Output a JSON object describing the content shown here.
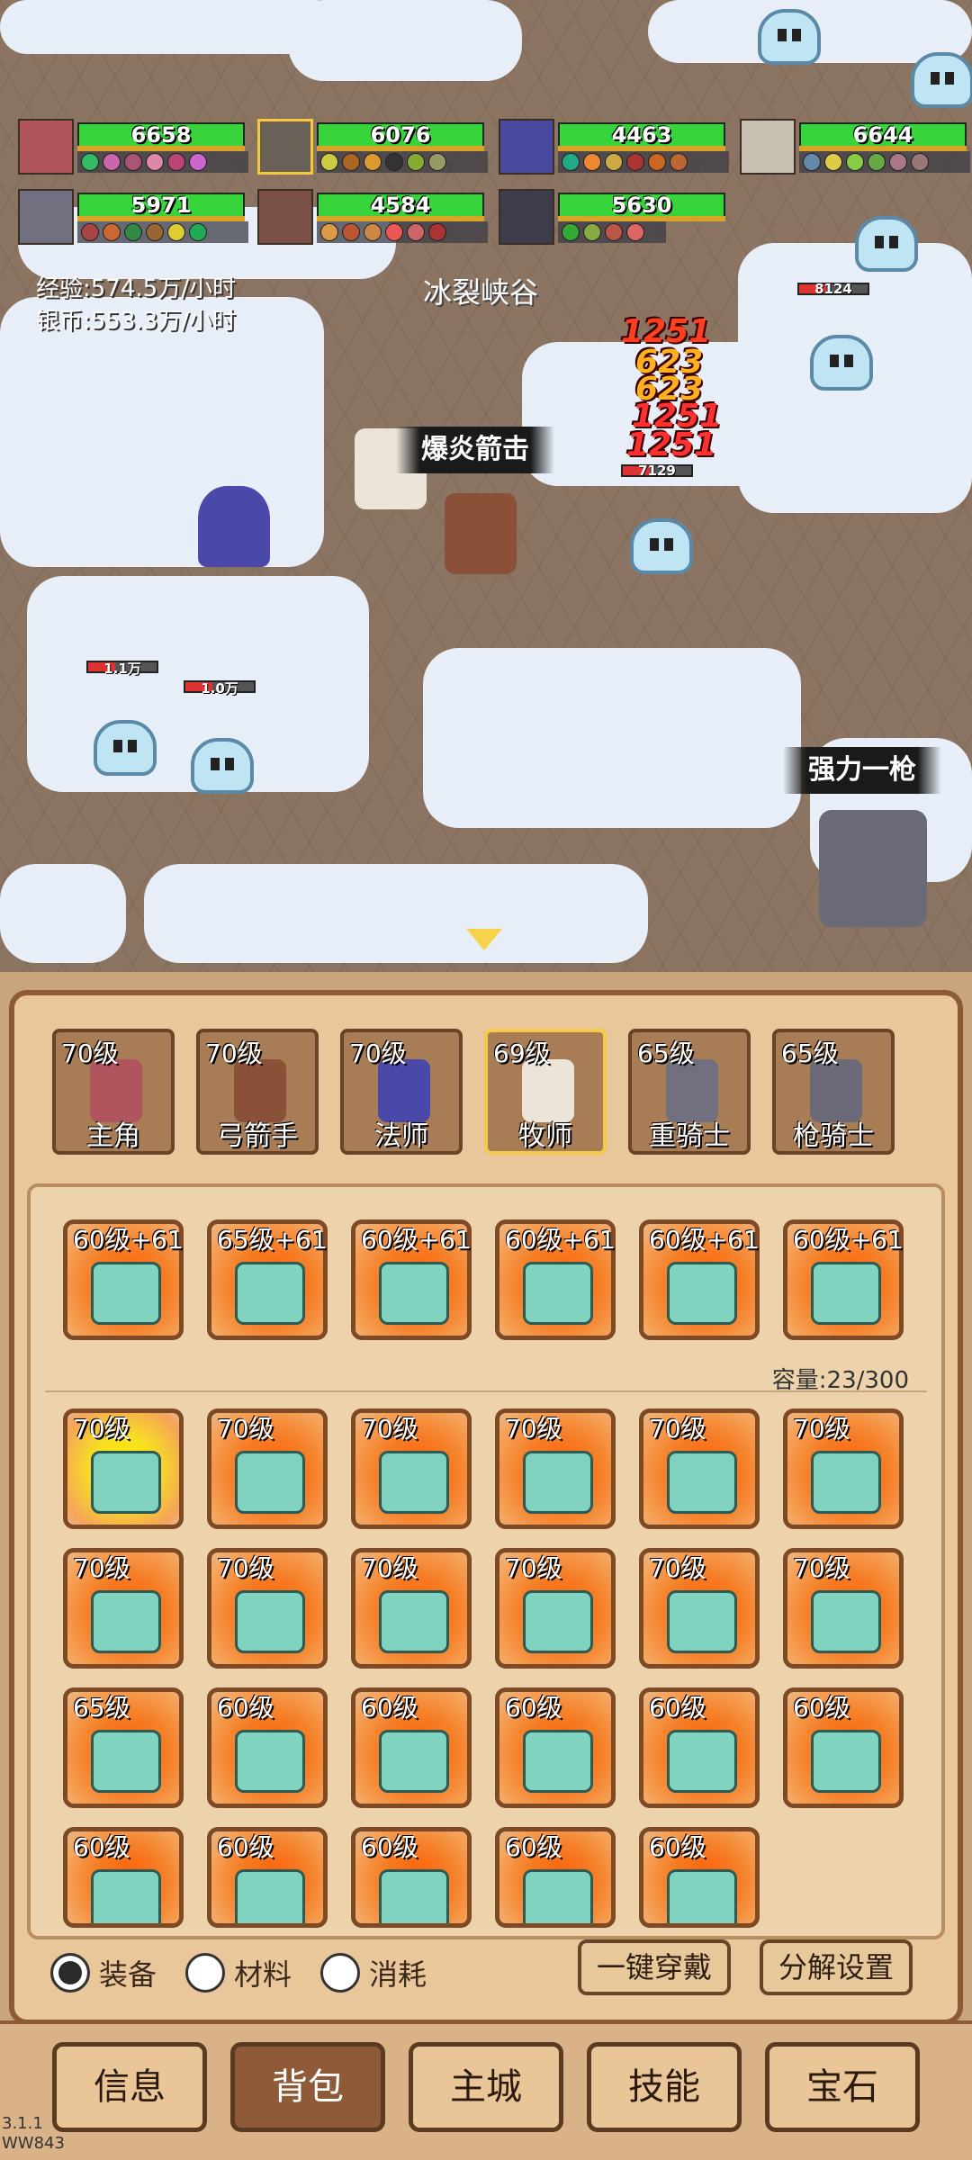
{
  "hud": {
    "party": [
      {
        "hp": "6658"
      },
      {
        "hp": "6076"
      },
      {
        "hp": "4463"
      },
      {
        "hp": "6644"
      },
      {
        "hp": "5971"
      },
      {
        "hp": "4584"
      },
      {
        "hp": "5630"
      }
    ],
    "exp_rate": "经验:574.5万/小时",
    "silver_rate": "银币:553.3万/小时",
    "zone_name": "冰裂峡谷"
  },
  "battle": {
    "skill_callout_1": "爆炎箭击",
    "skill_callout_2": "强力一枪",
    "enemy_hp_labels": [
      "8124",
      "7129",
      "1.1万",
      "1.0万"
    ],
    "damage_numbers": [
      "1251",
      "623",
      "623",
      "1251",
      "1251"
    ]
  },
  "party_tabs": [
    {
      "level": "70级",
      "name": "主角"
    },
    {
      "level": "70级",
      "name": "弓箭手"
    },
    {
      "level": "70级",
      "name": "法师"
    },
    {
      "level": "69级",
      "name": "牧师"
    },
    {
      "level": "65级",
      "name": "重骑士"
    },
    {
      "level": "65级",
      "name": "枪骑士"
    }
  ],
  "equipped": [
    {
      "level": "60级+61",
      "item": "sword-icon"
    },
    {
      "level": "65级+61",
      "item": "helmet-icon"
    },
    {
      "level": "60级+61",
      "item": "armor-icon"
    },
    {
      "level": "60级+61",
      "item": "pants-icon"
    },
    {
      "level": "60级+61",
      "item": "shoulder-icon"
    },
    {
      "level": "60级+61",
      "item": "boots-icon"
    }
  ],
  "capacity": "容量:23/300",
  "inventory": [
    {
      "level": "70级",
      "item": "bracer-icon",
      "rarity": "gold"
    },
    {
      "level": "70级",
      "item": "pants-icon"
    },
    {
      "level": "70级",
      "item": "bracer-icon"
    },
    {
      "level": "70级",
      "item": "sword-icon"
    },
    {
      "level": "70级",
      "item": "pants-icon"
    },
    {
      "level": "70级",
      "item": "boots-icon"
    },
    {
      "level": "70级",
      "item": "helmet-icon"
    },
    {
      "level": "70级",
      "item": "helmet-icon"
    },
    {
      "level": "70级",
      "item": "pants-icon"
    },
    {
      "level": "70级",
      "item": "pants-icon"
    },
    {
      "level": "70级",
      "item": "bracer-icon"
    },
    {
      "level": "70级",
      "item": "bracer-icon"
    },
    {
      "level": "65级",
      "item": "armor-icon"
    },
    {
      "level": "60级",
      "item": "sword-icon"
    },
    {
      "level": "60级",
      "item": "shoulder-icon"
    },
    {
      "level": "60级",
      "item": "armor-icon"
    },
    {
      "level": "60级",
      "item": "armor-icon"
    },
    {
      "level": "60级",
      "item": "sword-icon"
    },
    {
      "level": "60级",
      "item": "helmet-icon"
    },
    {
      "level": "60级",
      "item": "pants-icon"
    },
    {
      "level": "60级",
      "item": "pants-icon"
    },
    {
      "level": "60级",
      "item": "helmet-icon"
    },
    {
      "level": "60级",
      "item": "helmet-icon"
    }
  ],
  "filters": {
    "equipment": "装备",
    "materials": "材料",
    "consumables": "消耗"
  },
  "buttons": {
    "equip_all": "一键穿戴",
    "dismantle_settings": "分解设置"
  },
  "nav": {
    "info": "信息",
    "bag": "背包",
    "city": "主城",
    "skills": "技能",
    "gems": "宝石"
  },
  "version": {
    "line1": "3.1.1",
    "line2": "WW843"
  }
}
